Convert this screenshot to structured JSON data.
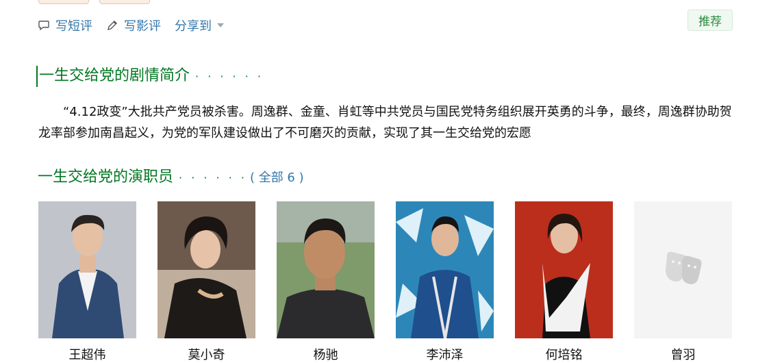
{
  "actions": {
    "short_review": "写短评",
    "movie_review": "写影评",
    "share": "分享到"
  },
  "recommend_label": "推荐",
  "intro": {
    "title": "一生交给党的剧情简介",
    "dots": "· · · · · ·",
    "text": "“4.12政变”大批共产党员被杀害。周逸群、金童、肖虹等中共党员与国民党特务组织展开英勇的斗争，最终，周逸群协助贺龙率部参加南昌起义，为党的军队建设做出了不可磨灭的贡献，实现了其一生交给党的宏愿"
  },
  "cast": {
    "title": "一生交给党的演职员",
    "dots": "· · · · · ·",
    "all_label": "( 全部 6 )",
    "members": [
      {
        "name": "王超伟"
      },
      {
        "name": "莫小奇"
      },
      {
        "name": "杨驰"
      },
      {
        "name": "李沛泽"
      },
      {
        "name": "何培铭"
      },
      {
        "name": "曾羽"
      }
    ]
  },
  "colors": {
    "link": "#3377aa",
    "title_green": "#007722",
    "recommend_bg": "#f0f8f2"
  }
}
